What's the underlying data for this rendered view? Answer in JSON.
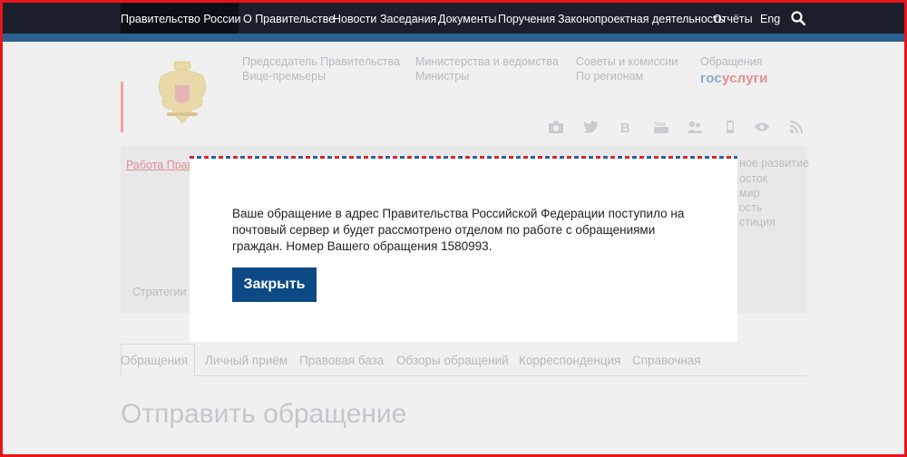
{
  "nav": {
    "items": [
      {
        "label": "Правительство России"
      },
      {
        "label": "О Правительстве"
      },
      {
        "label": "Новости"
      },
      {
        "label": "Заседания"
      },
      {
        "label": "Документы"
      },
      {
        "label": "Поручения"
      },
      {
        "label": "Законопроектная деятельность"
      },
      {
        "label": "Отчёты"
      },
      {
        "label": "Eng"
      }
    ],
    "search_icon": "search-icon"
  },
  "header": {
    "col1": [
      "Председатель Правительства",
      "Вице-премьеры"
    ],
    "col2": [
      "Министерства и ведомства",
      "Министры"
    ],
    "col3": [
      "Советы и комиссии",
      "По регионам"
    ],
    "col4": [
      "Обращения"
    ],
    "gosuslugi": {
      "part1": "гос",
      "part2": "услуги"
    },
    "social_icons": [
      "camera-icon",
      "twitter-icon",
      "vk-icon",
      "youtube-icon",
      "users-icon",
      "mobile-icon",
      "eye-icon",
      "rss-icon"
    ]
  },
  "panel": {
    "left_text": "Работа Прави",
    "right_items": [
      "ное развитие",
      "осток",
      "мир",
      "ость",
      "стиция"
    ],
    "strategy_label": "Стратегии"
  },
  "tabs": [
    "Обращения",
    "Личный приём",
    "Правовая база",
    "Обзоры обращений",
    "Корреспонденция",
    "Справочная"
  ],
  "page_title": "Отправить обращение",
  "modal": {
    "message": "Ваше обращение в адрес Правительства Российской Федерации поступило на почтовый сервер и будет рассмотрено отделом по работе с обращениями граждан. Номер Вашего обращения 1580993.",
    "close_label": "Закрыть"
  },
  "colors": {
    "accent_red": "#e8151b",
    "nav_dark": "#1a1f2b",
    "button_blue": "#0b4a84"
  }
}
